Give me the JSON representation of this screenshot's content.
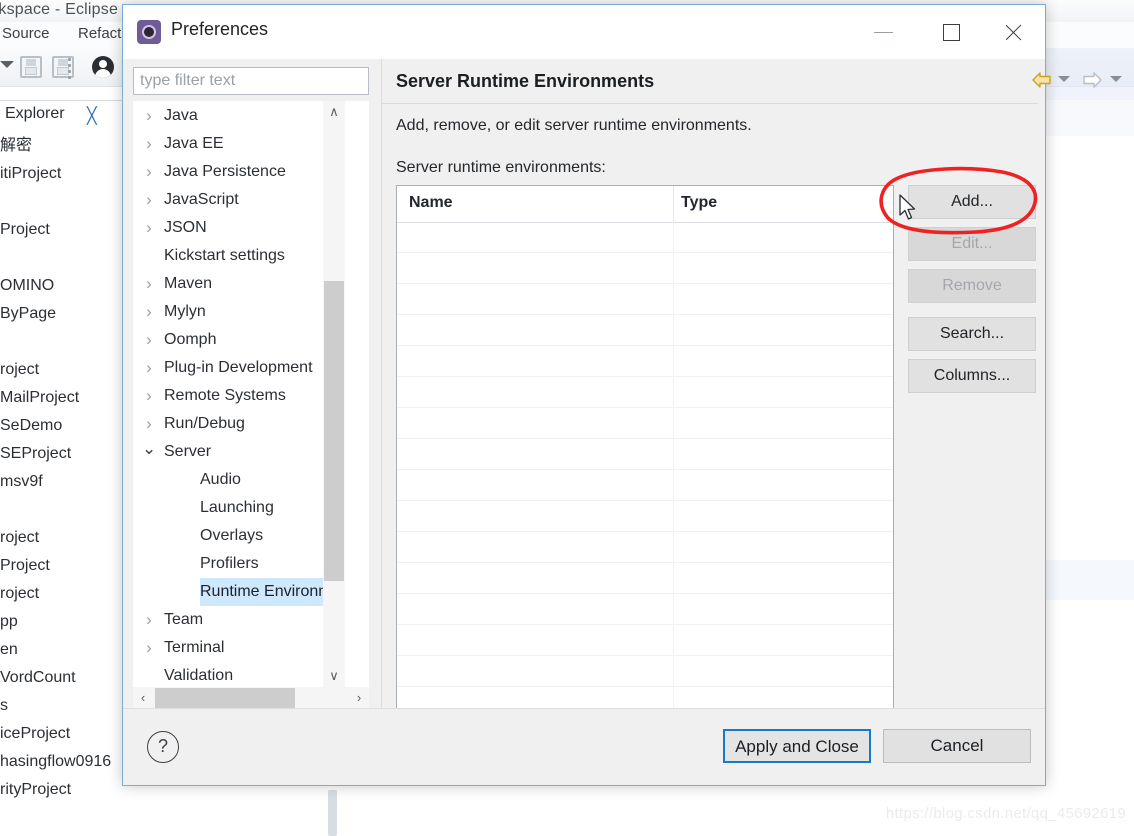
{
  "background": {
    "window_title": "workspace - Eclipse",
    "menus": [
      "Source",
      "Refactor"
    ],
    "toolbar_icons": [
      "dropdown-caret",
      "save-icon",
      "save-all-icon",
      "overflow-dots",
      "person-icon"
    ],
    "explorer_tab": {
      "label": "Explorer",
      "close_glyph": "╳"
    },
    "project_items": [
      "解密",
      "itiProject",
      "",
      "Project",
      "",
      "OMINO",
      "ByPage",
      "",
      "roject",
      "MailProject",
      "SeDemo",
      "SEProject",
      "msv9f",
      "",
      "roject",
      "Project",
      "roject",
      "pp",
      "en",
      "VordCount",
      "s",
      "iceProject",
      "hasingflow0916",
      "rityProject"
    ],
    "watermark": "https://blog.csdn.net/qq_45692619"
  },
  "dialog": {
    "title": "Preferences",
    "icon": "preferences-icon",
    "window_buttons": {
      "minimize": "—",
      "maximize": "□",
      "close": "✕"
    },
    "filter": {
      "placeholder": "type filter text",
      "value": ""
    },
    "tree": [
      {
        "label": "Java",
        "expandable": true,
        "expanded": false,
        "indent": 0
      },
      {
        "label": "Java EE",
        "expandable": true,
        "expanded": false,
        "indent": 0
      },
      {
        "label": "Java Persistence",
        "expandable": true,
        "expanded": false,
        "indent": 0
      },
      {
        "label": "JavaScript",
        "expandable": true,
        "expanded": false,
        "indent": 0
      },
      {
        "label": "JSON",
        "expandable": true,
        "expanded": false,
        "indent": 0
      },
      {
        "label": "Kickstart settings",
        "expandable": false,
        "expanded": false,
        "indent": 0
      },
      {
        "label": "Maven",
        "expandable": true,
        "expanded": false,
        "indent": 0
      },
      {
        "label": "Mylyn",
        "expandable": true,
        "expanded": false,
        "indent": 0
      },
      {
        "label": "Oomph",
        "expandable": true,
        "expanded": false,
        "indent": 0
      },
      {
        "label": "Plug-in Development",
        "expandable": true,
        "expanded": false,
        "indent": 0
      },
      {
        "label": "Remote Systems",
        "expandable": true,
        "expanded": false,
        "indent": 0
      },
      {
        "label": "Run/Debug",
        "expandable": true,
        "expanded": false,
        "indent": 0
      },
      {
        "label": "Server",
        "expandable": true,
        "expanded": true,
        "indent": 0
      },
      {
        "label": "Audio",
        "expandable": false,
        "expanded": false,
        "indent": 1
      },
      {
        "label": "Launching",
        "expandable": false,
        "expanded": false,
        "indent": 1
      },
      {
        "label": "Overlays",
        "expandable": false,
        "expanded": false,
        "indent": 1
      },
      {
        "label": "Profilers",
        "expandable": false,
        "expanded": false,
        "indent": 1
      },
      {
        "label": "Runtime Environm",
        "expandable": false,
        "expanded": false,
        "indent": 1,
        "selected": true
      },
      {
        "label": "Team",
        "expandable": true,
        "expanded": false,
        "indent": 0
      },
      {
        "label": "Terminal",
        "expandable": true,
        "expanded": false,
        "indent": 0
      },
      {
        "label": "Validation",
        "expandable": false,
        "expanded": false,
        "indent": 0
      }
    ],
    "scrollbar": {
      "up_glyph": "∧",
      "down_glyph": "∨",
      "left_glyph": "‹",
      "right_glyph": "›"
    },
    "page": {
      "title": "Server Runtime Environments",
      "description": "Add, remove, or edit server runtime environments.",
      "table_label": "Server runtime environments:",
      "nav": {
        "back_icon": "back-arrow-icon",
        "back_dropdown_icon": "chevron-down-icon",
        "forward_icon": "forward-arrow-icon",
        "forward_dropdown_icon": "chevron-down-icon",
        "menu_dropdown_icon": "chevron-down-icon"
      },
      "table": {
        "columns": [
          "Name",
          "Type"
        ],
        "rows": []
      },
      "buttons": [
        {
          "label": "Add...",
          "enabled": true,
          "highlighted": true
        },
        {
          "label": "Edit...",
          "enabled": false
        },
        {
          "label": "Remove",
          "enabled": false
        },
        {
          "label": "Search...",
          "enabled": true,
          "spaced": true
        },
        {
          "label": "Columns...",
          "enabled": true
        }
      ]
    },
    "footer": {
      "help_glyph": "?",
      "apply_label": "Apply and Close",
      "cancel_label": "Cancel"
    }
  },
  "annotation": {
    "color": "#ee2222",
    "shape": "hand-drawn-circle-around-add-button",
    "cursor": "mouse-pointer"
  }
}
